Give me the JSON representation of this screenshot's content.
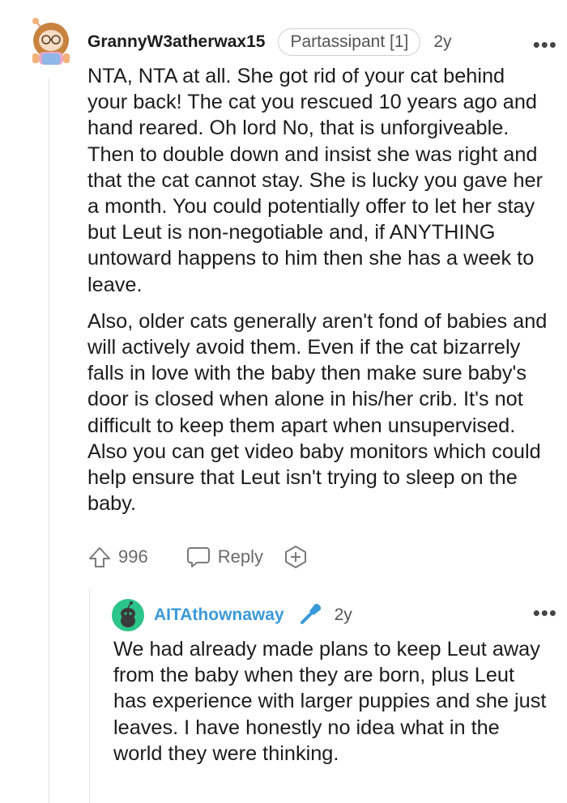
{
  "comment": {
    "username": "GrannyW3atherwax15",
    "flair": "Partassipant [1]",
    "time": "2y",
    "more": "•••",
    "paragraphs": [
      "NTA, NTA at all. She got rid of your cat behind your back! The cat you rescued 10 years ago and hand reared. Oh lord No, that is unforgiveable. Then to double down and insist she was right and that the cat cannot stay. She is lucky you gave her a month. You could potentially offer to let her stay but Leut is non-negotiable and, if ANYTHING untoward happens to him then she has a week to leave.",
      "Also, older cats generally aren't fond of babies and will actively avoid them. Even if the cat bizarrely falls in love with the baby then make sure baby's door is closed when alone in his/her crib. It's not difficult to keep them apart when unsupervised. Also you can get video baby monitors which could help ensure that Leut isn't trying to sleep on the baby."
    ],
    "score": "996",
    "reply_label": "Reply"
  },
  "reply": {
    "username": "AITAthownaway",
    "time": "2y",
    "more": "•••",
    "text": "We had already made plans to keep Leut away from the baby when they are born, plus Leut has experience with larger puppies and she just leaves. I have honestly no idea what in the world they were thinking."
  },
  "colors": {
    "accent_username": "#3a9ad9",
    "text": "#1c1c1c",
    "meta": "#6a6a6a",
    "avatar_green": "#2bc48a"
  }
}
